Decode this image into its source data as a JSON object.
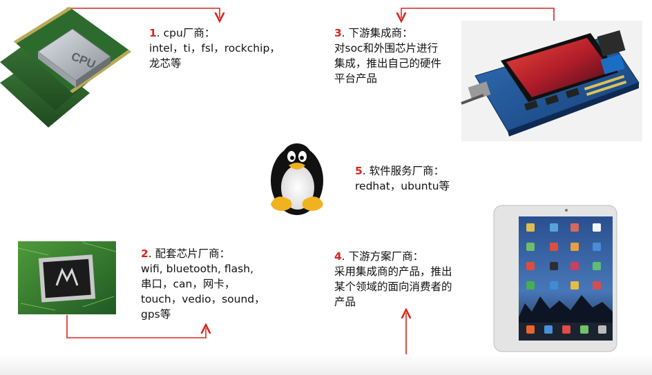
{
  "colors": {
    "accent": "#d8241b",
    "arrow": "#d8241b"
  },
  "icons": {
    "cpu": "cpu-chip-icon",
    "board": "development-board-icon",
    "linux": "tux-penguin-icon",
    "chip": "peripheral-chip-icon",
    "tablet": "tablet-icon"
  },
  "cpu_chip_label": "CPU",
  "nodes": [
    {
      "id": "cpu-vendor",
      "num": "1",
      "title": ". cpu厂商：",
      "lines": [
        "intel，ti，fsl，rockchip，",
        "龙芯等"
      ]
    },
    {
      "id": "peripheral-vendor",
      "num": "2",
      "title": ". 配套芯片厂商：",
      "lines": [
        "wifi, bluetooth, flash,",
        "串口，can，网卡，",
        "touch，vedio，sound，",
        "gps等"
      ]
    },
    {
      "id": "integrator",
      "num": "3",
      "title": ". 下游集成商：",
      "lines": [
        "对soc和外围芯片进行",
        "集成，推出自己的硬件",
        "平台产品"
      ]
    },
    {
      "id": "solution-vendor",
      "num": "4",
      "title": ". 下游方案厂商：",
      "lines": [
        "采用集成商的产品，推出",
        "某个领域的面向消费者的",
        "产品"
      ]
    },
    {
      "id": "software-service",
      "num": "5",
      "title": ". 软件服务厂商：",
      "lines": [
        "redhat，ubuntu等"
      ]
    }
  ]
}
